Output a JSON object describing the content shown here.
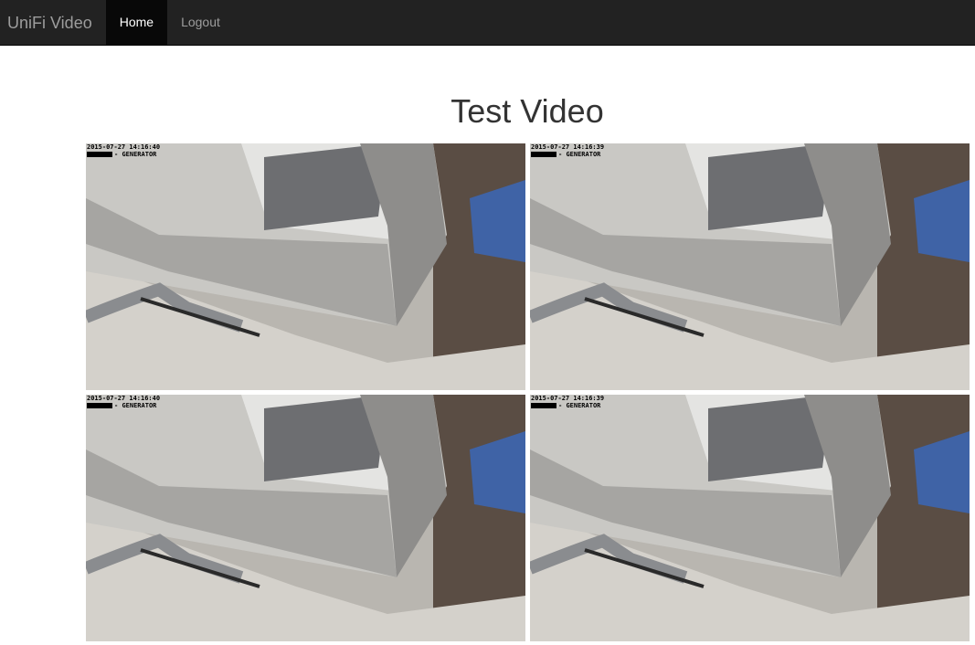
{
  "navbar": {
    "brand": "UniFi Video",
    "items": [
      {
        "label": "Home",
        "active": true
      },
      {
        "label": "Logout",
        "active": false
      }
    ]
  },
  "page": {
    "title": "Test Video"
  },
  "cameras": [
    {
      "timestamp": "2015-07-27 14:16:40",
      "label": "GENERATOR"
    },
    {
      "timestamp": "2015-07-27 14:16:39",
      "label": "GENERATOR"
    },
    {
      "timestamp": "2015-07-27 14:16:40",
      "label": "GENERATOR"
    },
    {
      "timestamp": "2015-07-27 14:16:39",
      "label": "GENERATOR"
    }
  ]
}
